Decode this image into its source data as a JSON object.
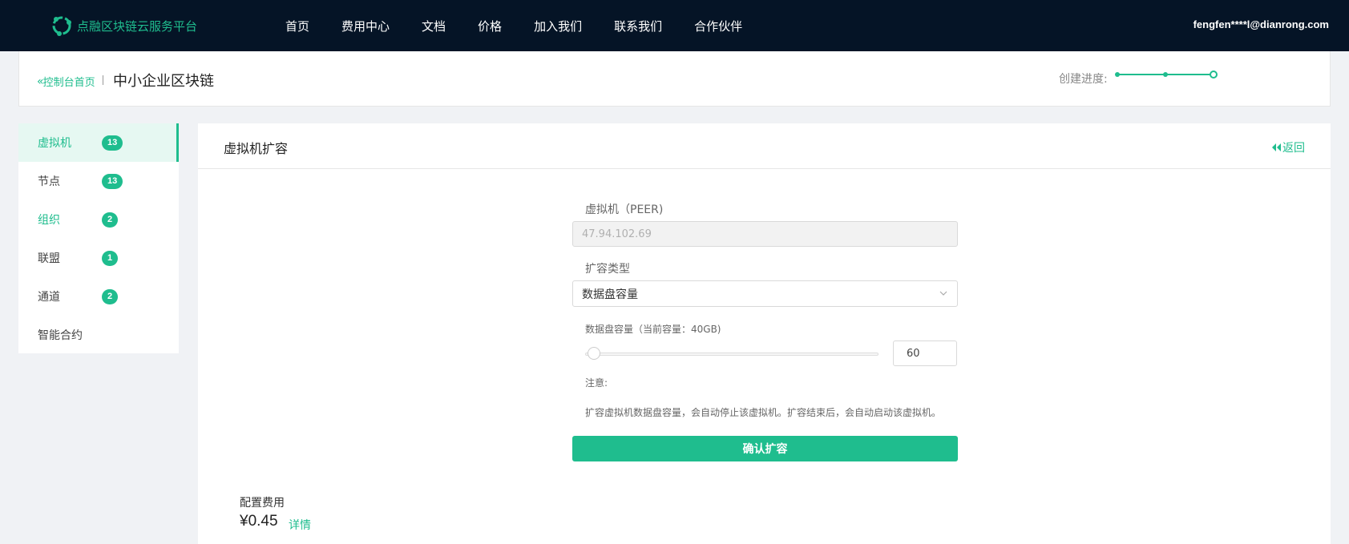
{
  "brand": {
    "name": "点融区块链云服务平台",
    "accent_color": "#1fbd8e",
    "nav_bg_color": "#051426"
  },
  "nav": {
    "items": [
      "首页",
      "费用中心",
      "文档",
      "价格",
      "加入我们",
      "联系我们",
      "合作伙伴"
    ]
  },
  "user": {
    "email": "fengfen****l@dianrong.com"
  },
  "breadcrumb": {
    "back_label": "控制台首页",
    "title": "中小企业区块链",
    "progress_label": "创建进度:"
  },
  "sidebar": {
    "items": [
      {
        "label": "虚拟机",
        "badge": "13",
        "active": true
      },
      {
        "label": "节点",
        "badge": "13"
      },
      {
        "label": "组织",
        "badge": "2"
      },
      {
        "label": "联盟",
        "badge": "1"
      },
      {
        "label": "通道",
        "badge": "2"
      },
      {
        "label": "智能合约"
      }
    ]
  },
  "panel": {
    "title": "虚拟机扩容",
    "back_label": "返回"
  },
  "form": {
    "vm_label": "虚拟机（PEER)",
    "vm_value": "47.94.102.69",
    "type_label": "扩容类型",
    "type_value": "数据盘容量",
    "capacity_label": "数据盘容量（当前容量：40GB)",
    "capacity_value": "60",
    "note_title": "注意:",
    "note_text": "扩容虚拟机数据盘容量，会自动停止该虚拟机。扩容结束后，会自动启动该虚拟机。",
    "confirm_label": "确认扩容"
  },
  "cost": {
    "label": "配置费用",
    "value": "¥0.45",
    "detail_label": "详情"
  }
}
